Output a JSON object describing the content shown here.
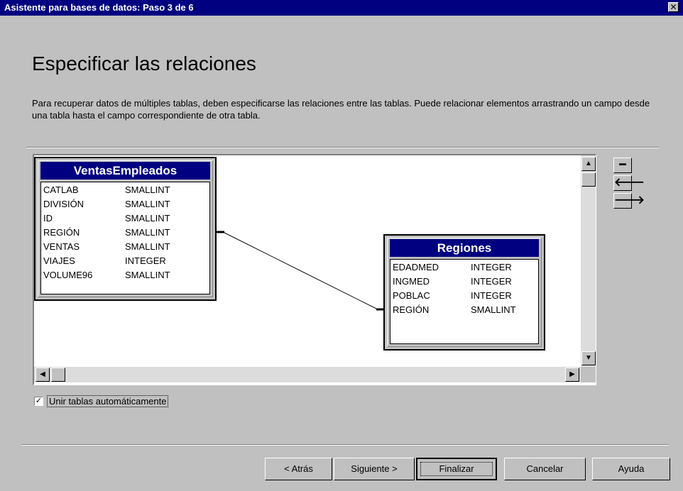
{
  "window": {
    "title": "Asistente para bases de datos: Paso 3 de 6",
    "close_glyph": "✕"
  },
  "page": {
    "heading": "Especificar las relaciones",
    "description": "Para recuperar datos de múltiples tablas, deben especificarse las relaciones entre las tablas. Puede relacionar elementos arrastrando un campo desde una tabla hasta el campo correspondiente de otra tabla."
  },
  "tables": [
    {
      "name": "VentasEmpleados",
      "fields": [
        {
          "name": "CATLAB",
          "type": "SMALLINT"
        },
        {
          "name": "DIVISIÓN",
          "type": "SMALLINT"
        },
        {
          "name": "ID",
          "type": "SMALLINT"
        },
        {
          "name": "REGIÓN",
          "type": "SMALLINT"
        },
        {
          "name": "VENTAS",
          "type": "SMALLINT"
        },
        {
          "name": "VIAJES",
          "type": "INTEGER"
        },
        {
          "name": "VOLUME96",
          "type": "SMALLINT"
        }
      ]
    },
    {
      "name": "Regiones",
      "fields": [
        {
          "name": "EDADMED",
          "type": "INTEGER"
        },
        {
          "name": "INGMED",
          "type": "INTEGER"
        },
        {
          "name": "POBLAC",
          "type": "INTEGER"
        },
        {
          "name": "REGIÓN",
          "type": "SMALLINT"
        }
      ]
    }
  ],
  "relationship": {
    "from_table": "VentasEmpleados",
    "from_field": "REGIÓN",
    "to_table": "Regiones",
    "to_field": "REGIÓN"
  },
  "side_controls": {
    "remove_icon": "━",
    "left_icon": "🡐",
    "right_icon": "🡒"
  },
  "scrollbars": {
    "up_icon": "▲",
    "down_icon": "▼",
    "left_icon": "◀",
    "right_icon": "▶"
  },
  "auto_join": {
    "label": "Unir tablas automáticamente",
    "checked": true,
    "check_glyph": "✓"
  },
  "buttons": {
    "back": "< Atrás",
    "next": "Siguiente >",
    "finish": "Finalizar",
    "cancel": "Cancelar",
    "help": "Ayuda"
  }
}
